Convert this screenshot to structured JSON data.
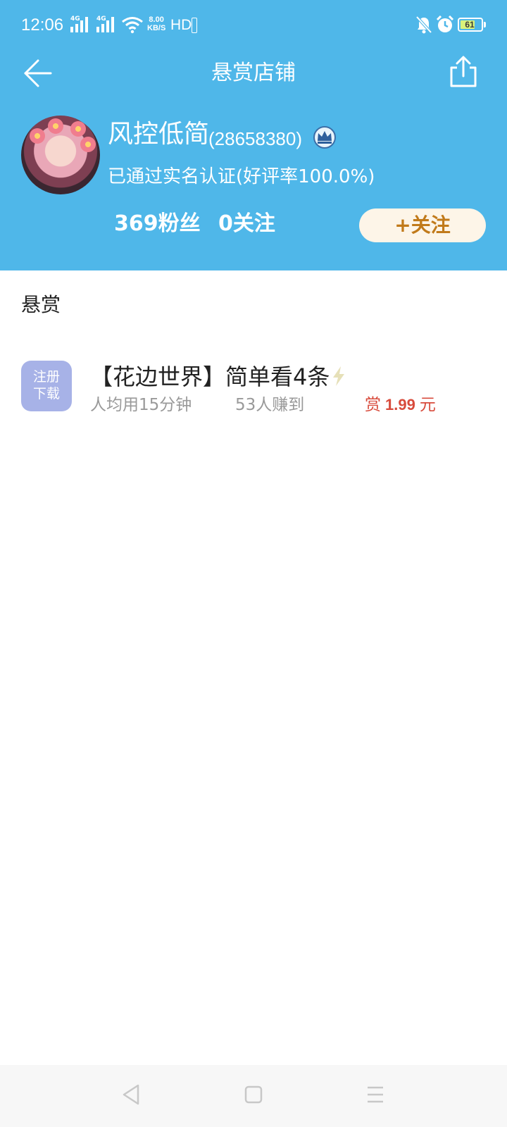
{
  "status_bar": {
    "time": "12:06",
    "network_1": "4G",
    "network_2": "4G",
    "speed_value": "8.00",
    "speed_unit": "KB/S",
    "hd": "HD",
    "battery": "61",
    "icons": [
      "signal-icon",
      "wifi-icon",
      "mute-bell-icon",
      "alarm-icon",
      "battery-icon"
    ]
  },
  "nav": {
    "title": "悬赏店铺",
    "back_icon": "back-arrow-icon",
    "share_icon": "share-icon"
  },
  "profile": {
    "name": "风控低简",
    "id": "(28658380)",
    "verify_text": "已通过实名认证(好评率100.0%)",
    "fans": "369粉丝",
    "following": "0关注",
    "follow_label": "+关注"
  },
  "section": {
    "title": "悬赏"
  },
  "tasks": [
    {
      "badge_line1": "注册",
      "badge_line2": "下载",
      "title": "【花边世界】简单看4条",
      "avg_time": "人均用15分钟",
      "earned": "53人赚到",
      "reward_label": "赏",
      "reward_value": "1.99",
      "reward_unit": "元"
    }
  ],
  "colors": {
    "header_bg": "#4fb7e9",
    "follow_text": "#c17a1a",
    "follow_bg": "#fdf5e8",
    "badge_bg": "#a7b2e7",
    "reward": "#d84b3c"
  }
}
